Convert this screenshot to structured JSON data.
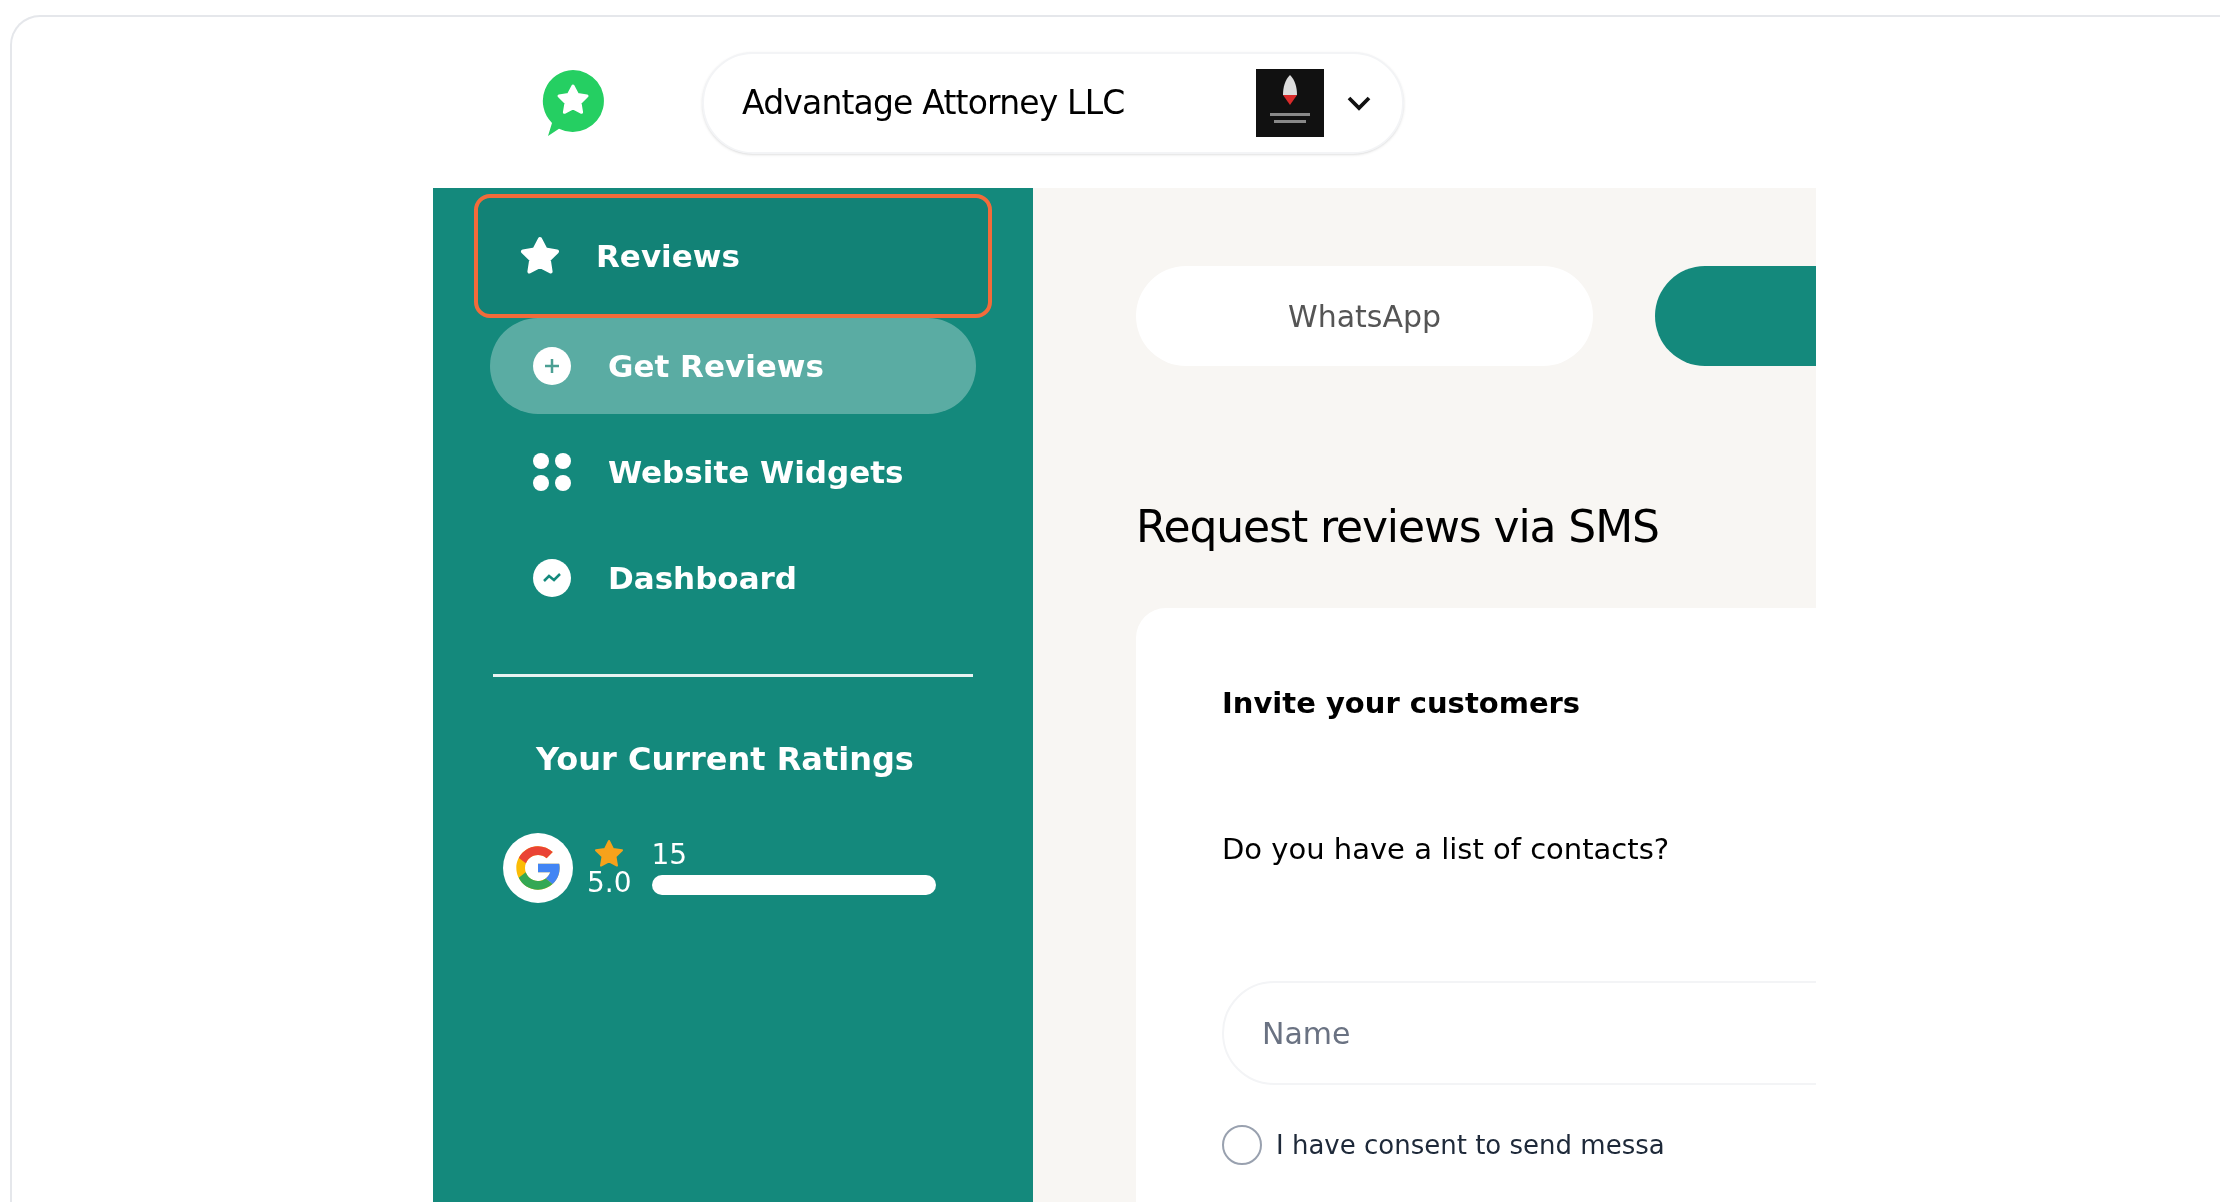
{
  "header": {
    "business_name": "Advantage Attorney LLC"
  },
  "sidebar": {
    "items": [
      {
        "label": "Reviews",
        "kind": "star",
        "selected": false,
        "highlighted": true
      },
      {
        "label": "Get Reviews",
        "kind": "plus",
        "selected": true,
        "highlighted": false
      },
      {
        "label": "Website Widgets",
        "kind": "grid",
        "selected": false,
        "highlighted": false
      },
      {
        "label": "Dashboard",
        "kind": "chart",
        "selected": false,
        "highlighted": false
      }
    ],
    "ratings_title": "Your Current Ratings",
    "ratings": [
      {
        "kind": "google",
        "score": "5.0",
        "count": "15"
      }
    ]
  },
  "main": {
    "channel_tabs": [
      {
        "label": "WhatsApp",
        "selected": false
      },
      {
        "selected": true
      }
    ],
    "heading": "Request reviews via SMS",
    "card": {
      "title": "Invite your customers",
      "question": "Do you have a list of contacts?",
      "name_field": {
        "placeholder": "Name"
      },
      "consent": {
        "label": "I have consent to send messa",
        "checked": false
      }
    }
  }
}
